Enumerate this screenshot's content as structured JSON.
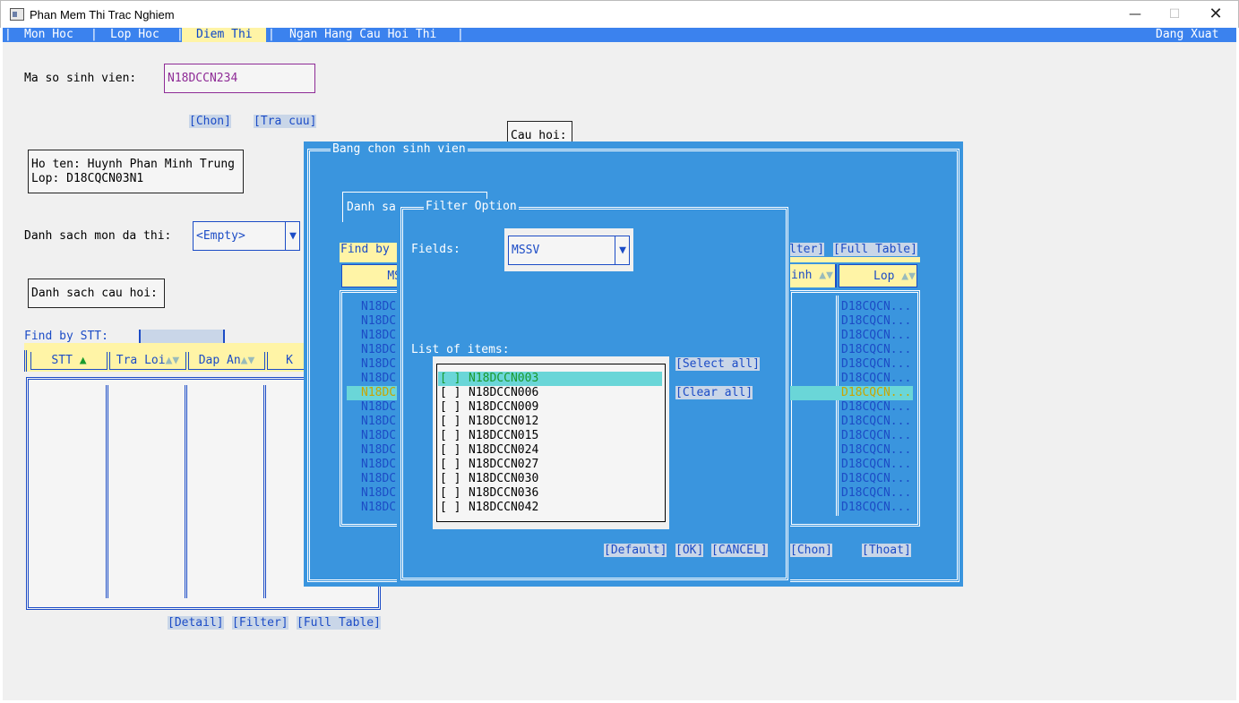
{
  "window": {
    "title": "Phan Mem Thi Trac Nghiem",
    "min_icon": "minimize-icon",
    "max_icon": "maximize-icon",
    "close_icon": "close-icon"
  },
  "menu": {
    "items": [
      {
        "label": "Mon Hoc",
        "active": false
      },
      {
        "label": "Lop Hoc",
        "active": false
      },
      {
        "label": "Diem Thi",
        "active": true
      },
      {
        "label": "Ngan Hang Cau Hoi Thi",
        "active": false
      }
    ],
    "right_label": "Dang Xuat",
    "accent": "#3b82ee"
  },
  "main": {
    "mssv_label": "Ma so sinh vien:",
    "mssv_value": "N18DCCN234",
    "chon_btn": "[Chon]",
    "tracuu_btn": "[Tra cuu]",
    "student_name": "Ho ten: Huynh Phan Minh Trung",
    "student_class": "Lop: D18CQCN03N1",
    "subjects_label": "Danh sach mon da thi:",
    "subjects_value": "<Empty>",
    "questions_label": "Danh sach cau hoi:",
    "cau_hoi_label": "Cau hoi:",
    "find_stt_label": "Find by STT:",
    "columns": [
      "STT",
      "Tra Loi",
      "Dap An",
      "K"
    ],
    "detail_btn": "[Detail]",
    "filter_btn": "[Filter]",
    "full_table_btn": "[Full Table]"
  },
  "dialog": {
    "title": "Bang chon sinh vien",
    "tab_label": "Danh sa",
    "find_label": "Find by",
    "filter_partial_btn": "lter]",
    "full_table_btn": "[Full Table]",
    "col_mssv": "MS",
    "col_sinh": "inh",
    "col_lop": "Lop",
    "mssv_rows": [
      "N18DC",
      "N18DC",
      "N18DC",
      "N18DC",
      "N18DC",
      "N18DC",
      "N18DC",
      "N18DC",
      "N18DC",
      "N18DC",
      "N18DC",
      "N18DC",
      "N18DC",
      "N18DC",
      "N18DC"
    ],
    "lop_rows": [
      "D18CQCN...",
      "D18CQCN...",
      "D18CQCN...",
      "D18CQCN...",
      "D18CQCN...",
      "D18CQCN...",
      "D18CQCN...",
      "D18CQCN...",
      "D18CQCN...",
      "D18CQCN...",
      "D18CQCN...",
      "D18CQCN...",
      "D18CQCN...",
      "D18CQCN...",
      "D18CQCN..."
    ],
    "selected_row_index": 6,
    "chon_btn": "[Chon]",
    "thoat_btn": "[Thoat]",
    "bg": "#3a95de"
  },
  "filter": {
    "title": "Filter Option",
    "fields_label": "Fields:",
    "fields_value": "MSSV",
    "list_label": "List of items:",
    "items": [
      {
        "check": "[ ]",
        "value": "N18DCCN003"
      },
      {
        "check": "[ ]",
        "value": "N18DCCN006"
      },
      {
        "check": "[ ]",
        "value": "N18DCCN009"
      },
      {
        "check": "[ ]",
        "value": "N18DCCN012"
      },
      {
        "check": "[ ]",
        "value": "N18DCCN015"
      },
      {
        "check": "[ ]",
        "value": "N18DCCN024"
      },
      {
        "check": "[ ]",
        "value": "N18DCCN027"
      },
      {
        "check": "[ ]",
        "value": "N18DCCN030"
      },
      {
        "check": "[ ]",
        "value": "N18DCCN036"
      },
      {
        "check": "[ ]",
        "value": "N18DCCN042"
      }
    ],
    "select_all_btn": "[Select all]",
    "clear_all_btn": "[Clear all]",
    "default_btn": "[Default]",
    "ok_btn": "[OK]",
    "cancel_btn": "[CANCEL]"
  }
}
